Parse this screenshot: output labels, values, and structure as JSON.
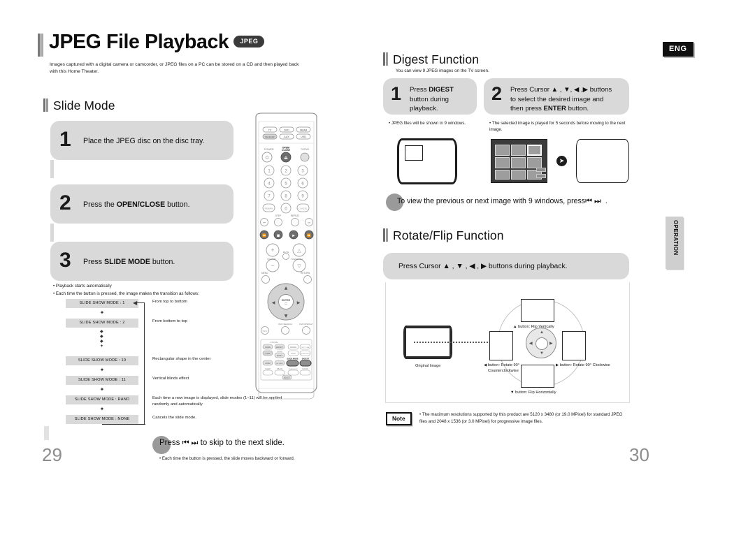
{
  "document": {
    "language_badge": "ENG",
    "side_tab": "OPERATION",
    "page_left": "29",
    "page_right": "30"
  },
  "left_page": {
    "title": "JPEG File Playback",
    "title_badge": "JPEG",
    "intro": "Images captured with a digital camera or camcorder, or JPEG files on a PC can be stored on a CD and then played back with this Home Theater.",
    "section_title": "Slide Mode",
    "steps": [
      {
        "num": "1",
        "text": "Place the JPEG disc on the disc tray."
      },
      {
        "num": "2",
        "text_pre": "Press the ",
        "text_bold": "OPEN/CLOSE",
        "text_post": " button."
      },
      {
        "num": "3",
        "text_pre": "Press ",
        "text_bold": "SLIDE MODE",
        "text_post": " button."
      }
    ],
    "bullets": [
      "Playback starts automatically",
      "Each time the button is pressed, the image makes the transition as follows:"
    ],
    "flow": [
      {
        "label": "SLIDE SHOW MODE : 1",
        "desc": "From top to bottom"
      },
      {
        "label": "SLIDE SHOW MODE : 2",
        "desc": "From bottom to top"
      },
      {
        "label": "SLIDE SHOW MODE : 10",
        "desc": "Rectangular shape in the center"
      },
      {
        "label": "SLIDE SHOW MODE : 11",
        "desc": "Vertical blinds effect"
      },
      {
        "label": "SLIDE SHOW MODE : RAND",
        "desc": "Each time a new image is displayed, slide modes (1~11) will be applied randomly and automatically"
      },
      {
        "label": "SLIDE SHOW MODE : NONE",
        "desc": "Cancels the slide mode."
      }
    ],
    "skip": {
      "pre": "Press ",
      "icons": "⏮ ⏭",
      "post": " to skip to the next slide.",
      "sub": "Each time the button is pressed, the slide moves backward or forward."
    }
  },
  "right_page": {
    "digest": {
      "section_title": "Digest Function",
      "sub": "You can view 9 JPEG images on the TV screen.",
      "step1": {
        "num": "1",
        "line1_pre": "Press ",
        "line1_bold": "DIGEST",
        "line2": "button during",
        "line3": "playback.",
        "note": "JPEG files will be shown in 9 windows."
      },
      "step2": {
        "num": "2",
        "line1": "Press Cursor ▲ , ▼, ◀ ,▶ buttons",
        "line2": "to select the desired image and",
        "line3_pre": "then press ",
        "line3_bold": "ENTER",
        "line3_post": " button.",
        "note": "The selected image is played for 5 seconds before moving to the next image."
      },
      "view_line_pre": "To view the previous or next image with 9 windows, press",
      "view_line_icons": "⏮ ⏭",
      "view_line_post": "."
    },
    "rotate": {
      "section_title": "Rotate/Flip Function",
      "press_line": "Press Cursor ▲ , ▼ , ◀ , ▶  buttons during playback.",
      "original_label": "Original Image",
      "labels": {
        "up": "▲ button: Flip Vertically",
        "down": "▼ button: Flip Horizontally",
        "left_1": "◀ button: Rotate 90°",
        "left_2": "Counterclockwise",
        "right": "▶ button: Rotate 90° Clockwise"
      }
    },
    "note": {
      "badge": "Note",
      "text": "The maximum resolutions supported by this product are 5120 x 3480 (or 19.0 MPixel) for standard JPEG files and 2048 x 1536 (or 3.0 MPixel) for progressive image files."
    }
  },
  "remote": {
    "source_buttons": [
      "TV",
      "DVD",
      "FM/AM",
      "DVD RECEIVER",
      "AUX",
      "USB"
    ],
    "labels": {
      "power": "POWER",
      "open_close": "OPEN/CLOSE",
      "tv_dvd": "TV/DVD",
      "step": "STEP",
      "repeat": "REPEAT",
      "volume": "VOLUME",
      "mute": "MUTE",
      "tuning_ch": "TUNING/CH",
      "menu": "MENU",
      "return": "RETURN",
      "enter": "ENTER",
      "info": "INFO",
      "dvd_search": "DVD SEARCH",
      "dvd_display": "DVD DISPLAY",
      "slide_mode": "SLIDE MODE",
      "digest": "DIGEST",
      "zoom": "ZOOM",
      "sleep": "SLEEP"
    },
    "numbers": [
      "1",
      "2",
      "3",
      "4",
      "5",
      "6",
      "7",
      "8",
      "9",
      "0"
    ],
    "remain": "REMAIN",
    "cancel": "CANCEL"
  },
  "colors": {
    "grey_box": "#d9d9d9",
    "dark_text": "#111111",
    "accent_dark": "#3a3a3a",
    "page_number": "#8d8d8d",
    "screen_bg": "#3b3b3b"
  }
}
